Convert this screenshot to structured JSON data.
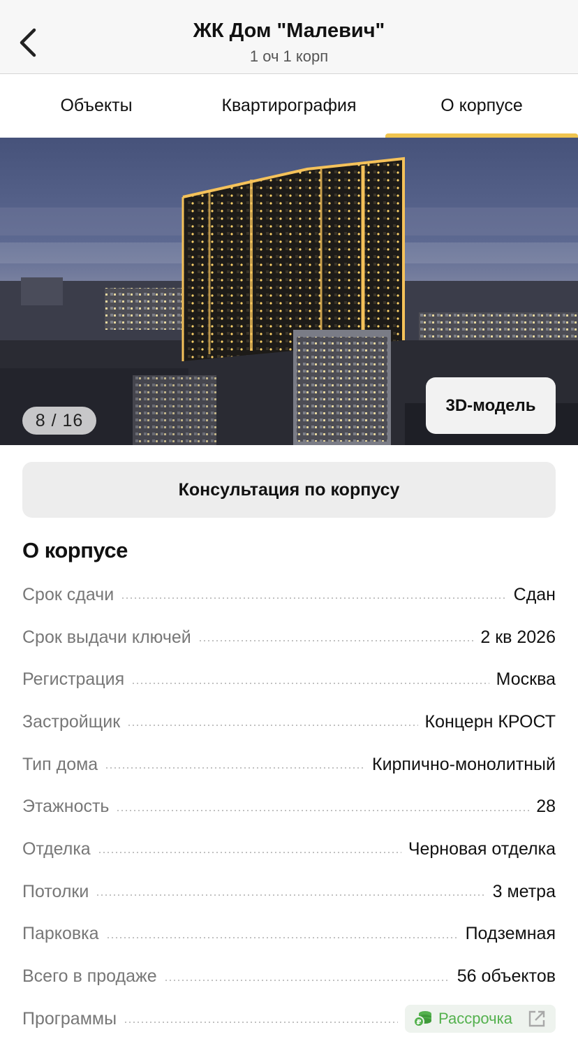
{
  "header": {
    "title": "ЖК Дом \"Малевич\"",
    "subtitle": "1 оч 1 корп"
  },
  "tabs": [
    {
      "label": "Объекты",
      "active": false
    },
    {
      "label": "Квартирография",
      "active": false
    },
    {
      "label": "О корпусе",
      "active": true
    }
  ],
  "gallery": {
    "counter": "8 / 16",
    "model_button": "3D-модель"
  },
  "consult_button": "Консультация по корпусу",
  "section_title": "О корпусе",
  "specs": [
    {
      "label": "Срок сдачи",
      "value": "Сдан"
    },
    {
      "label": "Срок выдачи ключей",
      "value": "2 кв 2026"
    },
    {
      "label": "Регистрация",
      "value": "Москва"
    },
    {
      "label": "Застройщик",
      "value": "Концерн КРОСТ"
    },
    {
      "label": "Тип дома",
      "value": "Кирпично-монолитный"
    },
    {
      "label": "Этажность",
      "value": "28"
    },
    {
      "label": "Отделка",
      "value": "Черновая отделка"
    },
    {
      "label": "Потолки",
      "value": "3 метра"
    },
    {
      "label": "Парковка",
      "value": "Подземная"
    },
    {
      "label": "Всего в продаже",
      "value": "56 объектов"
    },
    {
      "label": "Программы",
      "value": "Рассрочка"
    }
  ],
  "colors": {
    "accent_tab": "#f0c44f",
    "program_chip_text": "#54b14e"
  },
  "icons": {
    "back": "chevron-left-icon",
    "program": "coins-icon",
    "external": "external-link-icon"
  }
}
